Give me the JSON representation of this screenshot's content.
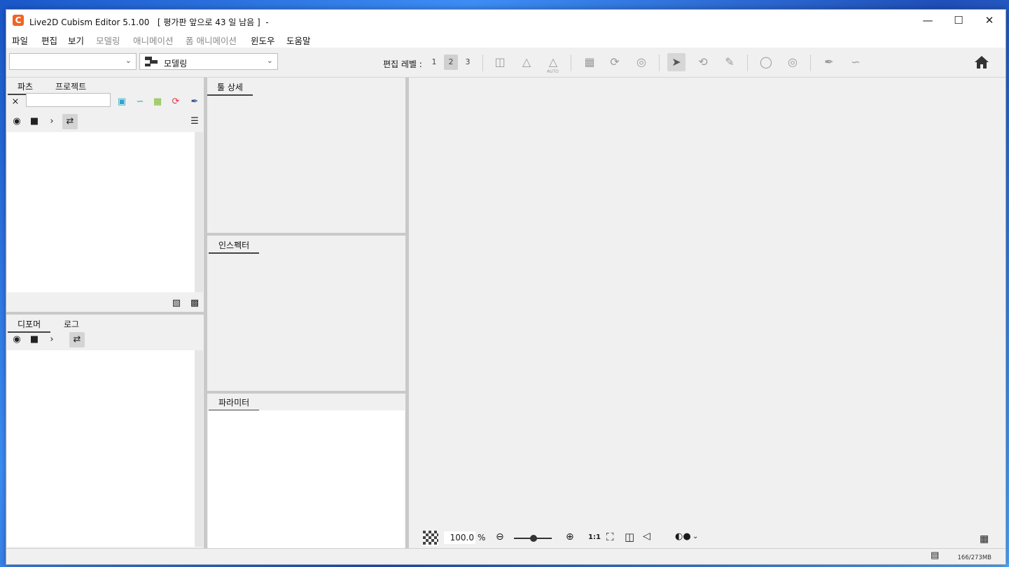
{
  "window": {
    "title": "Live2D Cubism Editor 5.1.00   [ 평가판 앞으로 43 일 남음 ]  -",
    "minimize": "—",
    "maximize": "☐",
    "close": "✕",
    "logo_letter": "C"
  },
  "menu": {
    "items": [
      {
        "label": "파일"
      },
      {
        "label": "편집"
      },
      {
        "label": "보기"
      },
      {
        "label": "모델링"
      },
      {
        "label": "애니메이션"
      },
      {
        "label": "폼 애니메이션"
      },
      {
        "label": "윈도우"
      },
      {
        "label": "도움말"
      }
    ]
  },
  "toolbar": {
    "document_combo_value": "",
    "workspace_combo_value": "모델링",
    "edit_level_label": "편집 레벨 :",
    "edit_levels": [
      "1",
      "2",
      "3"
    ],
    "active_edit_level": "2",
    "auto_label": "AUTO"
  },
  "parts_panel": {
    "tabs": [
      "파츠",
      "프로젝트"
    ],
    "search_value": ""
  },
  "deformer_panel": {
    "tabs": [
      "디포머",
      "로그"
    ]
  },
  "tool_detail_panel": {
    "title": "툴 상세"
  },
  "inspector_panel": {
    "title": "인스펙터"
  },
  "parameter_panel": {
    "title": "파라미터"
  },
  "viewport": {
    "zoom_value": "100.0",
    "zoom_unit": "%",
    "one_to_one": "1:1"
  },
  "status": {
    "memory": "166/273MB"
  },
  "colors": {
    "logo": "#f06425",
    "accent_teal": "#2aa7c9",
    "accent_green": "#7cba2e",
    "accent_red": "#e2334a",
    "accent_navy": "#3a4f8c"
  }
}
